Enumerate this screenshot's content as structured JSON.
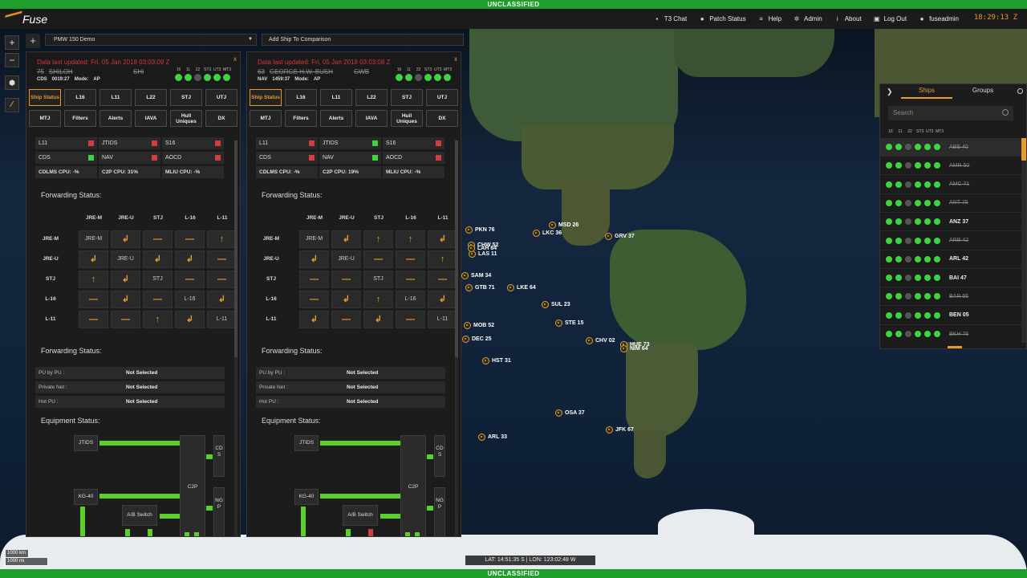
{
  "classification": "UNCLASSIFIED",
  "brand": "Fuse",
  "nav": [
    {
      "id": "chat",
      "label": "T3 Chat",
      "icon": "chat-icon"
    },
    {
      "id": "patch",
      "label": "Patch Status",
      "icon": "circle-icon"
    },
    {
      "id": "help",
      "label": "Help",
      "icon": "list-icon"
    },
    {
      "id": "admin",
      "label": "Admin",
      "icon": "gear-icon"
    },
    {
      "id": "about",
      "label": "About",
      "icon": "info-icon"
    },
    {
      "id": "logout",
      "label": "Log Out",
      "icon": "lock-icon"
    },
    {
      "id": "user",
      "label": "fuseadmin",
      "icon": "user-icon"
    }
  ],
  "clock": "18:29:13 Z",
  "zoom": {
    "in": "+",
    "out": "−"
  },
  "demo": {
    "select": "PMW 150 Demo",
    "add_compare": "Add Ship To Comparison",
    "add_tab": "+"
  },
  "light_labels": [
    "16",
    "11",
    "22",
    "ST3",
    "UT3",
    "MT3"
  ],
  "panels": [
    {
      "updated": "Data last updated: Fri, 05 Jan 2018 03:03:09 Z",
      "close": "x",
      "hull": "75",
      "name": "SHILOH",
      "code": "SHI",
      "sys": "CDS",
      "sysval": "0019:27",
      "mode_label": "Mode:",
      "mode": "AP",
      "lights": [
        "on",
        "on",
        "off",
        "on",
        "on",
        "on"
      ],
      "stats": [
        {
          "label": "L11",
          "st": "bad"
        },
        {
          "label": "JTIDS",
          "st": "bad"
        },
        {
          "label": "S16",
          "st": "bad"
        },
        {
          "label": "CDS",
          "st": "ok"
        },
        {
          "label": "NAV",
          "st": "bad"
        },
        {
          "label": "AOCD",
          "st": "bad"
        }
      ],
      "cpu": [
        "CDLMS CPU: -%",
        "C2P CPU: 31%",
        "MLIU CPU: -%"
      ],
      "grid": [
        [
          "JRE-M",
          "↲",
          "—",
          "—",
          "↑"
        ],
        [
          "↲",
          "JRE-U",
          "↲",
          "↲",
          "—"
        ],
        [
          "↑",
          "↲",
          "STJ",
          "—",
          "—"
        ],
        [
          "—",
          "↲",
          "—",
          "L-16",
          "↲"
        ],
        [
          "—",
          "—",
          "↑",
          "↲",
          "L-11"
        ]
      ]
    },
    {
      "updated": "Data last updated: Fri, 05 Jan 2018 03:03:08 Z",
      "close": "x",
      "hull": "63",
      "name": "GEORGE H.W. BUSH",
      "code": "GWB",
      "sys": "NAV",
      "sysval": "1459:37",
      "mode_label": "Mode:",
      "mode": "AP",
      "lights": [
        "on",
        "on",
        "off",
        "on",
        "on",
        "on"
      ],
      "stats": [
        {
          "label": "L11",
          "st": "bad"
        },
        {
          "label": "JTIDS",
          "st": "ok"
        },
        {
          "label": "S16",
          "st": "bad"
        },
        {
          "label": "CDS",
          "st": "bad"
        },
        {
          "label": "NAV",
          "st": "ok"
        },
        {
          "label": "AOCD",
          "st": "bad"
        }
      ],
      "cpu": [
        "CDLMS CPU: -%",
        "C2P CPU: 19%",
        "MLIU CPU: -%"
      ],
      "grid": [
        [
          "JRE-M",
          "↲",
          "↑",
          "↑",
          "↲"
        ],
        [
          "↲",
          "JRE-U",
          "—",
          "—",
          "↑"
        ],
        [
          "—",
          "—",
          "STJ",
          "—",
          "—"
        ],
        [
          "—",
          "↲",
          "↑",
          "L-16",
          "↲"
        ],
        [
          "↲",
          "—",
          "↲",
          "—",
          "L-11"
        ]
      ]
    }
  ],
  "tabs": [
    [
      "Ship Status",
      "L16",
      "L11",
      "L22",
      "STJ",
      "UTJ"
    ],
    [
      "MTJ",
      "Filters",
      "Alerts",
      "IAVA",
      "Hull Uniques",
      "DX"
    ]
  ],
  "forwarding_title": "Forwarding Status:",
  "grid_heads": [
    "JRE-M",
    "JRE-U",
    "STJ",
    "L-16",
    "L-11"
  ],
  "pu_rows": [
    {
      "k": "PU by PU :",
      "v": "Not Selected"
    },
    {
      "k": "Private Net :",
      "v": "Not Selected"
    },
    {
      "k": "Hot PU :",
      "v": "Not Selected"
    }
  ],
  "equipment_title": "Equipment Status:",
  "equip": {
    "jtids": "JTIDS",
    "kg": "KG-40",
    "ab": "A/B Switch",
    "c2p": "C2P Rehost",
    "cds": "CDS",
    "ngp": "NGP"
  },
  "map_ships": [
    {
      "n": "PKN 76"
    },
    {
      "n": "MSD 26"
    },
    {
      "n": "LKC 36"
    },
    {
      "n": "GRV 37"
    },
    {
      "n": "CHW 52"
    },
    {
      "n": "LAS 11"
    },
    {
      "n": "SAM 34"
    },
    {
      "n": "GTB 71"
    },
    {
      "n": "LKE 64"
    },
    {
      "n": "SUL 23"
    },
    {
      "n": "STE 15"
    },
    {
      "n": "MOB 52"
    },
    {
      "n": "DEC 25"
    },
    {
      "n": "CHV 02"
    },
    {
      "n": "HUE 73"
    },
    {
      "n": "NIM 64"
    },
    {
      "n": "HST 31"
    },
    {
      "n": "OSA 37"
    },
    {
      "n": "JFK 67"
    },
    {
      "n": "ARL 33"
    },
    {
      "n": "LAH 64"
    }
  ],
  "right_panel": {
    "tabs": [
      "Ships",
      "Groups"
    ],
    "search_placeholder": "Search",
    "items": [
      {
        "n": "ABE 40",
        "on": false,
        "l": [
          "on",
          "on",
          "off",
          "on",
          "on",
          "on"
        ]
      },
      {
        "n": "AMR 50",
        "on": false,
        "l": [
          "on",
          "on",
          "off",
          "on",
          "on",
          "on"
        ]
      },
      {
        "n": "AMC 71",
        "on": false,
        "l": [
          "on",
          "on",
          "off",
          "on",
          "on",
          "on"
        ]
      },
      {
        "n": "ANT 75",
        "on": false,
        "l": [
          "on",
          "on",
          "off",
          "on",
          "on",
          "on"
        ]
      },
      {
        "n": "ANZ 37",
        "on": true,
        "l": [
          "on",
          "on",
          "off",
          "on",
          "on",
          "on"
        ]
      },
      {
        "n": "ARB 42",
        "on": false,
        "l": [
          "on",
          "on",
          "off",
          "on",
          "on",
          "on"
        ]
      },
      {
        "n": "ARL 42",
        "on": true,
        "l": [
          "on",
          "on",
          "off",
          "on",
          "on",
          "on"
        ]
      },
      {
        "n": "BAI 47",
        "on": true,
        "l": [
          "on",
          "on",
          "off",
          "on",
          "on",
          "on"
        ]
      },
      {
        "n": "BAR 55",
        "on": false,
        "l": [
          "on",
          "on",
          "off",
          "on",
          "on",
          "on"
        ]
      },
      {
        "n": "BEN 05",
        "on": true,
        "l": [
          "on",
          "on",
          "off",
          "on",
          "on",
          "on"
        ]
      },
      {
        "n": "BKH 76",
        "on": false,
        "l": [
          "on",
          "on",
          "off",
          "on",
          "on",
          "on"
        ]
      }
    ]
  },
  "scale": [
    "1000 km",
    "1000 mi"
  ],
  "coords": "LAT: 14:51:35 S | LON: 123:02:48 W",
  "colors": {
    "accent": "#e89a2a",
    "ok": "#3fd43f",
    "bad": "#d43d3d",
    "banner": "#1e9e2b"
  }
}
